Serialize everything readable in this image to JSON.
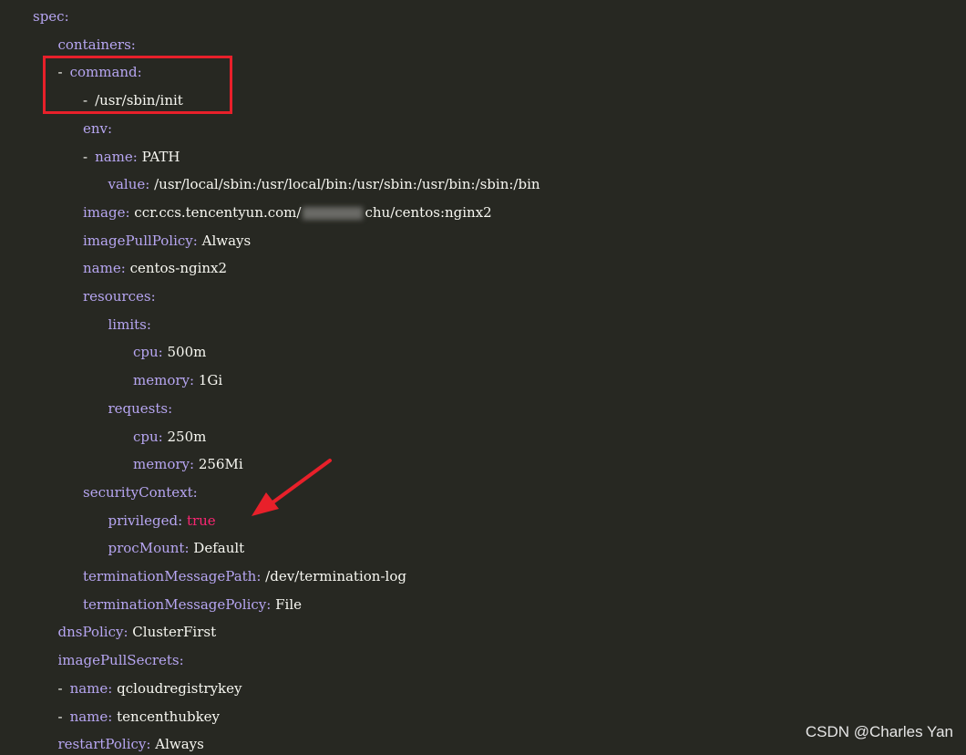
{
  "lines": [
    {
      "indent": 0,
      "dash": false,
      "key": "spec",
      "value": ""
    },
    {
      "indent": 1,
      "dash": false,
      "key": "containers",
      "value": ""
    },
    {
      "indent": 1,
      "dash": true,
      "key": "command",
      "value": ""
    },
    {
      "indent": 2,
      "dash": true,
      "key": "",
      "value": "/usr/sbin/init"
    },
    {
      "indent": 2,
      "dash": false,
      "key": "env",
      "value": ""
    },
    {
      "indent": 2,
      "dash": true,
      "key": "name",
      "value": "PATH"
    },
    {
      "indent": 3,
      "dash": false,
      "key": "value",
      "value": "/usr/local/sbin:/usr/local/bin:/usr/sbin:/usr/bin:/sbin:/bin"
    },
    {
      "indent": 2,
      "dash": false,
      "key": "image",
      "value": "ccr.ccs.tencentyun.com/",
      "value_suffix": "chu/centos:nginx2",
      "redacted": true
    },
    {
      "indent": 2,
      "dash": false,
      "key": "imagePullPolicy",
      "value": "Always"
    },
    {
      "indent": 2,
      "dash": false,
      "key": "name",
      "value": "centos-nginx2"
    },
    {
      "indent": 2,
      "dash": false,
      "key": "resources",
      "value": ""
    },
    {
      "indent": 3,
      "dash": false,
      "key": "limits",
      "value": ""
    },
    {
      "indent": 4,
      "dash": false,
      "key": "cpu",
      "value": "500m"
    },
    {
      "indent": 4,
      "dash": false,
      "key": "memory",
      "value": "1Gi"
    },
    {
      "indent": 3,
      "dash": false,
      "key": "requests",
      "value": ""
    },
    {
      "indent": 4,
      "dash": false,
      "key": "cpu",
      "value": "250m"
    },
    {
      "indent": 4,
      "dash": false,
      "key": "memory",
      "value": "256Mi"
    },
    {
      "indent": 2,
      "dash": false,
      "key": "securityContext",
      "value": ""
    },
    {
      "indent": 3,
      "dash": false,
      "key": "privileged",
      "value": "true",
      "bool": true
    },
    {
      "indent": 3,
      "dash": false,
      "key": "procMount",
      "value": "Default"
    },
    {
      "indent": 2,
      "dash": false,
      "key": "terminationMessagePath",
      "value": "/dev/termination-log"
    },
    {
      "indent": 2,
      "dash": false,
      "key": "terminationMessagePolicy",
      "value": "File"
    },
    {
      "indent": 1,
      "dash": false,
      "key": "dnsPolicy",
      "value": "ClusterFirst"
    },
    {
      "indent": 1,
      "dash": false,
      "key": "imagePullSecrets",
      "value": ""
    },
    {
      "indent": 1,
      "dash": true,
      "key": "name",
      "value": "qcloudregistrykey"
    },
    {
      "indent": 1,
      "dash": true,
      "key": "name",
      "value": "tencenthubkey"
    },
    {
      "indent": 1,
      "dash": false,
      "key": "restartPolicy",
      "value": "Always"
    }
  ],
  "watermark": "CSDN @Charles Yan",
  "colors": {
    "background": "#272822",
    "key": "#b7a6f2",
    "value": "#f8f8f2",
    "bool": "#f92672",
    "annotation": "#e8202a"
  }
}
